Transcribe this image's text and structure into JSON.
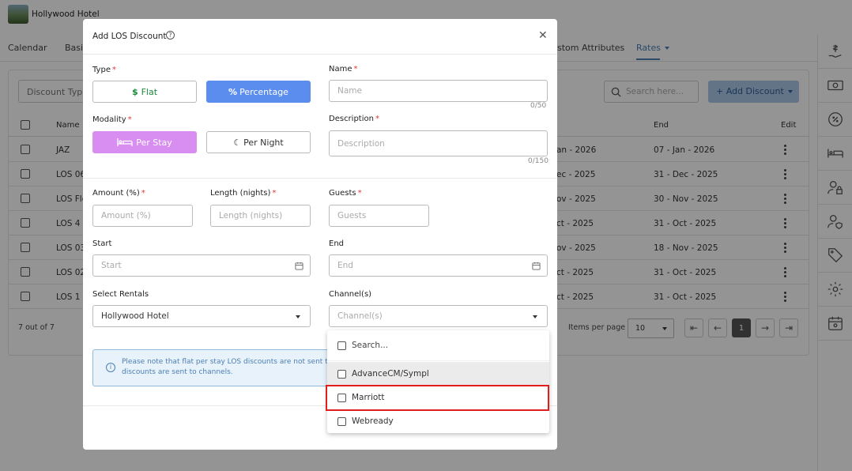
{
  "app": {
    "hotel_name": "Hollywood Hotel"
  },
  "nav": {
    "tabs": [
      "Calendar",
      "Basi",
      "stom Attributes",
      "Rates"
    ]
  },
  "toolbar": {
    "discount_type_placeholder": "Discount Type",
    "search_placeholder": "Search here...",
    "add_discount_label": "+ Add Discount"
  },
  "table": {
    "headers": {
      "name": "Name",
      "end": "End",
      "edit": "Edit"
    },
    "rows": [
      {
        "name": "JAZ",
        "start": "an - 2026",
        "end": "07 - Jan - 2026"
      },
      {
        "name": "LOS 06",
        "start": "ec - 2025",
        "end": "31 - Dec - 2025"
      },
      {
        "name": "LOS Flo",
        "start": "ov - 2025",
        "end": "30 - Nov - 2025"
      },
      {
        "name": "LOS 4",
        "start": "ct - 2025",
        "end": "31 - Oct - 2025"
      },
      {
        "name": "LOS 03",
        "start": "ov - 2025",
        "end": "18 - Nov - 2025"
      },
      {
        "name": "LOS 02",
        "start": "ct - 2025",
        "end": "31 - Oct - 2025"
      },
      {
        "name": "LOS 1 -",
        "start": "ct - 2025",
        "end": "31 - Oct - 2025"
      }
    ]
  },
  "pagination": {
    "count_text": "7 out of 7",
    "items_per_page_label": "Items per page",
    "items_per_page": "10",
    "current_page": "1"
  },
  "modal": {
    "title": "Add LOS Discount",
    "type": {
      "label": "Type",
      "flat": "Flat",
      "percentage": "Percentage"
    },
    "name": {
      "label": "Name",
      "placeholder": "Name",
      "counter": "0/50"
    },
    "modality": {
      "label": "Modality",
      "per_stay": "Per Stay",
      "per_night": "Per Night"
    },
    "description": {
      "label": "Description",
      "placeholder": "Description",
      "counter": "0/150"
    },
    "amount": {
      "label": "Amount (%)",
      "placeholder": "Amount (%)"
    },
    "length": {
      "label": "Length (nights)",
      "placeholder": "Length (nights)"
    },
    "guests": {
      "label": "Guests",
      "placeholder": "Guests"
    },
    "start": {
      "label": "Start",
      "placeholder": "Start"
    },
    "end": {
      "label": "End",
      "placeholder": "End"
    },
    "rentals": {
      "label": "Select Rentals",
      "value": "Hollywood Hotel"
    },
    "channels": {
      "label": "Channel(s)",
      "placeholder": "Channel(s)"
    },
    "info": {
      "line1": "Please note that flat per stay LOS discounts are not sent to",
      "line2": "discounts are sent to channels."
    }
  },
  "dropdown": {
    "search_placeholder": "Search...",
    "options": [
      "AdvanceCM/Sympl",
      "Marriott",
      "Webready"
    ]
  },
  "colors": {
    "accent": "#5b8def",
    "pink": "#d88ef0",
    "highlight": "#e01e1e",
    "link": "#4c7fb3"
  }
}
